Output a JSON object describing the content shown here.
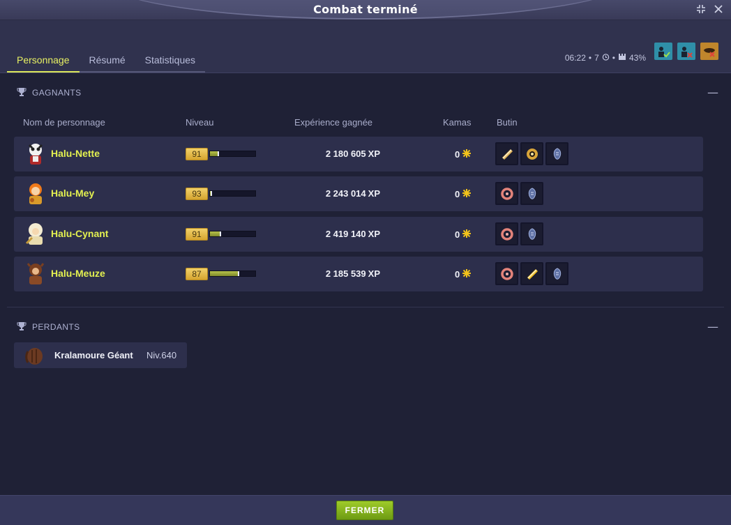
{
  "window": {
    "title": "Combat terminé",
    "minimize_icon": "compress-icon",
    "close_icon": "close-icon"
  },
  "tabs": [
    {
      "label": "Personnage",
      "active": true
    },
    {
      "label": "Résumé",
      "active": false
    },
    {
      "label": "Statistiques",
      "active": false
    }
  ],
  "fight_info": {
    "duration": "06:22",
    "turns": "7",
    "challenge": "43%"
  },
  "winners": {
    "title": "GAGNANTS",
    "columns": {
      "name": "Nom de personnage",
      "level": "Niveau",
      "xp": "Expérience gagnée",
      "kamas": "Kamas",
      "loot": "Butin"
    },
    "rows": [
      {
        "name": "Halu-Nette",
        "level": "91",
        "xp": "2 180 605",
        "xp_progress": 0.2,
        "kamas": "0",
        "loot": [
          "scroll",
          "orb",
          "relic"
        ]
      },
      {
        "name": "Halu-Mey",
        "level": "93",
        "xp": "2 243 014",
        "xp_progress": 0.05,
        "kamas": "0",
        "loot": [
          "ring",
          "relic"
        ]
      },
      {
        "name": "Halu-Cynant",
        "level": "91",
        "xp": "2 419 140",
        "xp_progress": 0.25,
        "kamas": "0",
        "loot": [
          "ring",
          "relic"
        ]
      },
      {
        "name": "Halu-Meuze",
        "level": "87",
        "xp": "2 185 539",
        "xp_progress": 0.65,
        "kamas": "0",
        "loot": [
          "ring",
          "scroll",
          "relic"
        ]
      }
    ],
    "xp_unit": "XP"
  },
  "losers": {
    "title": "PERDANTS",
    "rows": [
      {
        "name": "Kralamoure Géant",
        "level": "Niv.640"
      }
    ]
  },
  "footer": {
    "close_label": "FERMER"
  },
  "colors": {
    "accent": "#e3f050",
    "button": "#8bb81f",
    "row_bg": "#2d2f4c"
  }
}
